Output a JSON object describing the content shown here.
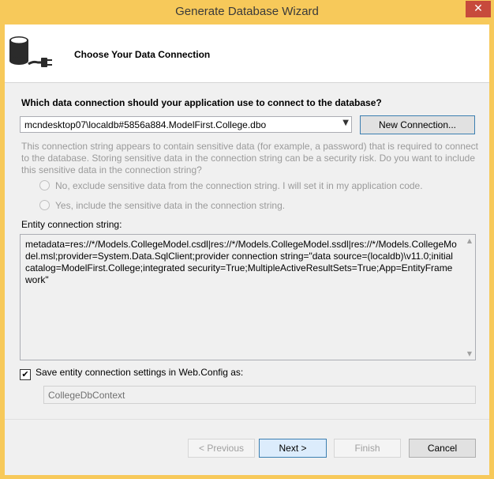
{
  "window": {
    "title": "Generate Database Wizard",
    "close_glyph": "✕"
  },
  "header": {
    "title": "Choose Your Data Connection",
    "icon": "database-plug-icon"
  },
  "connection": {
    "question": "Which data connection should your application use to connect to the database?",
    "selected": "mcndesktop07\\localdb#5856a884.ModelFirst.College.dbo",
    "new_connection_label": "New Connection..."
  },
  "sensitive": {
    "warning": "This connection string appears to contain sensitive data (for example, a password) that is required to connect to the database. Storing sensitive data in the connection string can be a security risk. Do you want to include this sensitive data in the connection string?",
    "option_no": "No, exclude sensitive data from the connection string. I will set it in my application code.",
    "option_yes": "Yes, include the sensitive data in the connection string."
  },
  "entity": {
    "label": "Entity connection string:",
    "value": "metadata=res://*/Models.CollegeModel.csdl|res://*/Models.CollegeModel.ssdl|res://*/Models.CollegeModel.msl;provider=System.Data.SqlClient;provider connection string=\"data source=(localdb)\\v11.0;initial catalog=ModelFirst.College;integrated security=True;MultipleActiveResultSets=True;App=EntityFramework\""
  },
  "save": {
    "checkbox_label": "Save entity connection settings in Web.Config as:",
    "checked": true,
    "check_glyph": "✔",
    "context_name": "CollegeDbContext"
  },
  "footer": {
    "previous": "< Previous",
    "next": "Next >",
    "finish": "Finish",
    "cancel": "Cancel"
  },
  "colors": {
    "title_bar": "#f7c95a",
    "close_button": "#c74a3c",
    "accent_border": "#3c7fb1"
  }
}
